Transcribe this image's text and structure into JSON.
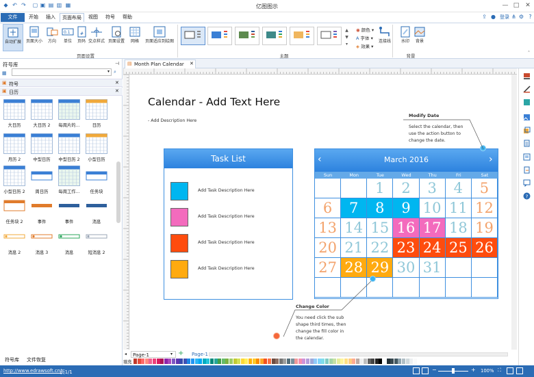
{
  "app": {
    "title": "亿图图示"
  },
  "menu": {
    "file": "文件",
    "items": [
      "开始",
      "插入",
      "页面布局",
      "视图",
      "符号",
      "帮助"
    ],
    "login": "登录"
  },
  "ribbon": {
    "page_buttons": [
      "自动扩展",
      "页面大小",
      "方向",
      "单位",
      "页码",
      "交点样式",
      "页面设置",
      "网格",
      "页面适应到绘图"
    ],
    "group_page_setup": "页面设置",
    "group_theme": "主题",
    "group_background": "背景",
    "color_label": "颜色",
    "font_label": "字体",
    "effect_label": "效果",
    "connector_label": "连接线",
    "watermark_label": "水印",
    "background_label": "背景"
  },
  "library": {
    "title": "符号库",
    "search_placeholder": "",
    "section_symbols": "符号",
    "section_calendar": "日历",
    "items": [
      {
        "label": "大日历"
      },
      {
        "label": "大日历 2"
      },
      {
        "label": "每周片的..."
      },
      {
        "label": "日历"
      },
      {
        "label": "月历 2"
      },
      {
        "label": "中型日历"
      },
      {
        "label": "中型日历 2"
      },
      {
        "label": "小型日历"
      },
      {
        "label": "小型日历 2"
      },
      {
        "label": "周日历"
      },
      {
        "label": "每周工作..."
      },
      {
        "label": "任务块"
      },
      {
        "label": "任务块 2"
      },
      {
        "label": "事件"
      },
      {
        "label": "事件"
      },
      {
        "label": "消息"
      },
      {
        "label": "消息 2"
      },
      {
        "label": "消息 3"
      },
      {
        "label": "消息"
      },
      {
        "label": "短消息 2"
      }
    ],
    "bottom_tabs": [
      "符号库",
      "文件恢复"
    ]
  },
  "document": {
    "tab_title": "Month Plan Calendar"
  },
  "canvas": {
    "title": "Calendar - Add Text Here",
    "description": "- Add Description Here",
    "task_list": {
      "header": "Task List",
      "items": [
        {
          "text": "Add Task Description Here",
          "color": "#00b6f0"
        },
        {
          "text": "Add Task Description Here",
          "color": "#f36bbd"
        },
        {
          "text": "Add Task Description Here",
          "color": "#fe4c0e"
        },
        {
          "text": "Add Task Description Here",
          "color": "#ffaa10"
        }
      ]
    },
    "calendar": {
      "month": "March 2016",
      "weekdays": [
        "Sun",
        "Mon",
        "Tue",
        "Wed",
        "Thu",
        "Fri",
        "Sat"
      ],
      "rows": [
        [
          "",
          "",
          "1",
          "2",
          "3",
          "4",
          "5"
        ],
        [
          "6",
          "7",
          "8",
          "9",
          "10",
          "11",
          "12"
        ],
        [
          "13",
          "14",
          "15",
          "16",
          "17",
          "18",
          "19"
        ],
        [
          "20",
          "21",
          "22",
          "23",
          "24",
          "25",
          "26"
        ],
        [
          "27",
          "28",
          "29",
          "30",
          "31",
          "",
          ""
        ],
        [
          "",
          "",
          "",
          "",
          "",
          "",
          ""
        ]
      ],
      "highlights": {
        "7": "#00b6f0",
        "8": "#00b6f0",
        "9": "#00b6f0",
        "16": "#f36bbd",
        "17": "#f36bbd",
        "23": "#fe4c0e",
        "24": "#fe4c0e",
        "25": "#fe4c0e",
        "26": "#fe4c0e",
        "28": "#ffaa10",
        "29": "#ffaa10"
      }
    },
    "callout_modify": {
      "title": "Modify Date",
      "body": "Select the calendar, then use the action button to change the date."
    },
    "callout_change": {
      "title": "Change Color",
      "body": "You need click the sub shape third times, then change the fill color in the calendar."
    }
  },
  "pages": {
    "tab1": "Page-1",
    "tab2": "Page-1",
    "fill_label": "填充"
  },
  "status": {
    "url": "http://www.edrawsoft.cn/",
    "page": "页1/1",
    "zoom": "100%"
  },
  "colors": {
    "accent": "#2b6cb5",
    "header_blue": "#3d8fe0"
  }
}
